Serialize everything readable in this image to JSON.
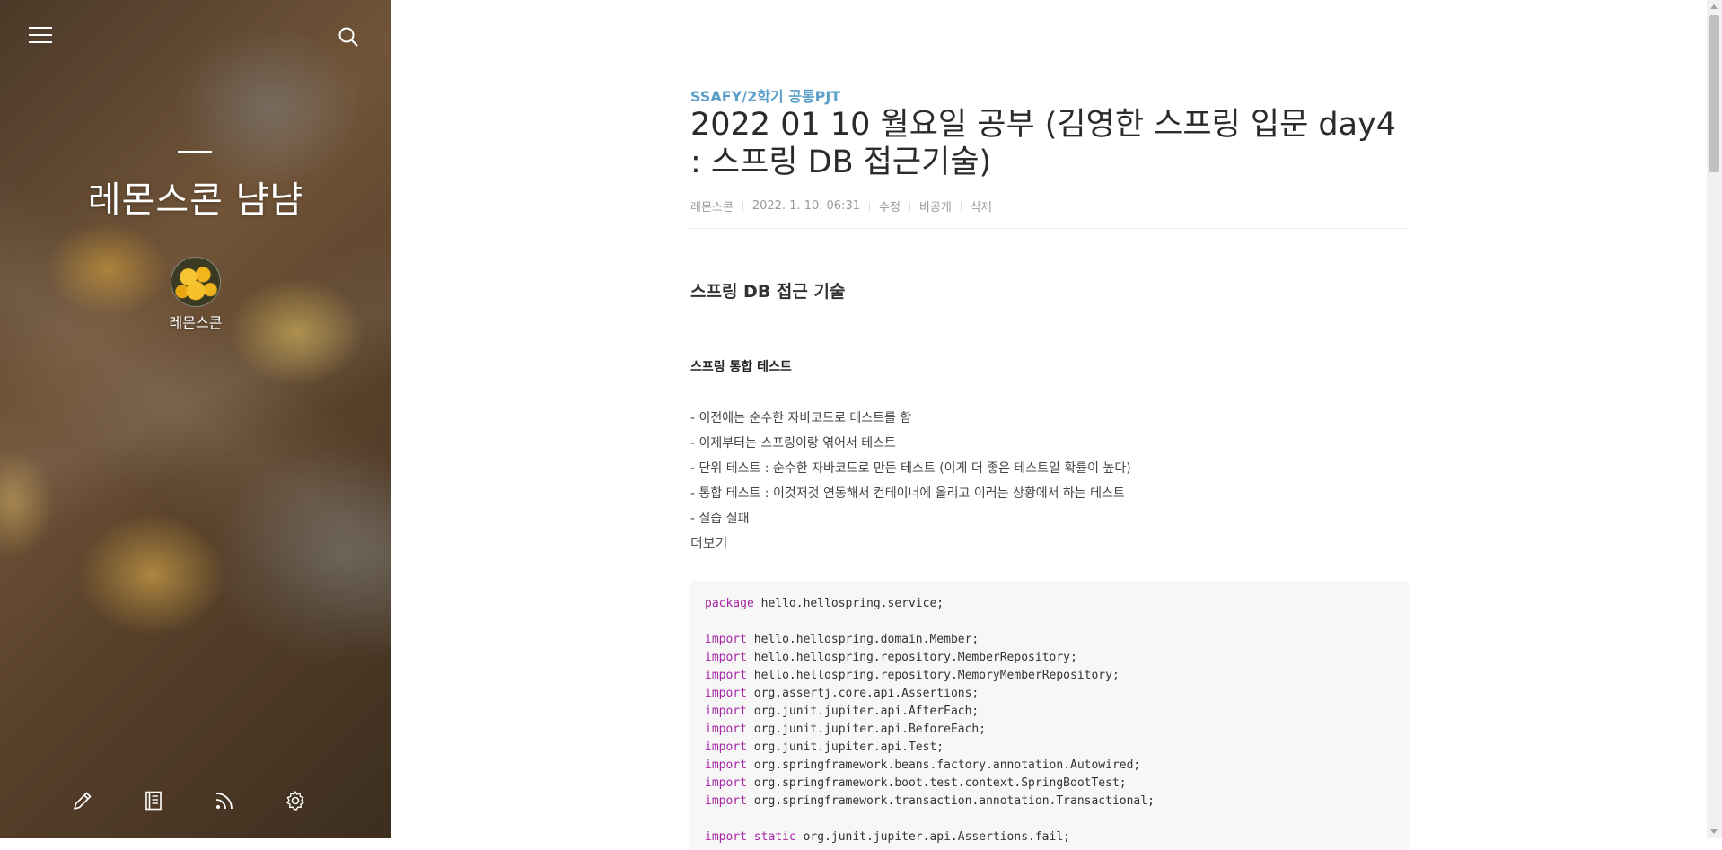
{
  "sidebar": {
    "menu_icon": "hamburger-icon",
    "search_icon": "search-icon",
    "blog_title": "레몬스콘 냠냠",
    "author_name": "레몬스콘",
    "bottom_icons": [
      "pencil-icon",
      "notebook-icon",
      "rss-icon",
      "gear-icon"
    ]
  },
  "post": {
    "category": "SSAFY/2학기 공통PJT",
    "title": "2022 01 10 월요일 공부 (김영한 스프링 입문 day4 : 스프링 DB 접근기술)",
    "meta": {
      "author": "레몬스콘",
      "date": "2022. 1. 10. 06:31",
      "edit": "수정",
      "visibility": "비공개",
      "delete": "삭제"
    },
    "section_heading": "스프링 DB 접근 기술",
    "sub_heading": "스프링 통합 테스트",
    "bullets": [
      "- 이전에는 순수한 자바코드로 테스트를 함",
      "- 이제부터는 스프링이랑 엮어서 테스트",
      "- 단위 테스트 : 순수한 자바코드로 만든 테스트 (이게 더 좋은 테스트일 확률이 높다)",
      "- 통합 테스트 : 이것저것 연동해서 컨테이너에 올리고 이러는 상황에서 하는 테스트",
      "- 실습 실패"
    ],
    "more_link": "더보기",
    "code": {
      "line1": {
        "kw": "package",
        "rest": " hello.hellospring.service;"
      },
      "imports": [
        {
          "kw": "import",
          "rest": " hello.hellospring.domain.Member;"
        },
        {
          "kw": "import",
          "rest": " hello.hellospring.repository.MemberRepository;"
        },
        {
          "kw": "import",
          "rest": " hello.hellospring.repository.MemoryMemberRepository;"
        },
        {
          "kw": "import",
          "rest": " org.assertj.core.api.Assertions;"
        },
        {
          "kw": "import",
          "rest": " org.junit.jupiter.api.AfterEach;"
        },
        {
          "kw": "import",
          "rest": " org.junit.jupiter.api.BeforeEach;"
        },
        {
          "kw": "import",
          "rest": " org.junit.jupiter.api.Test;"
        },
        {
          "kw": "import",
          "rest": " org.springframework.beans.factory.annotation.Autowired;"
        },
        {
          "kw": "import",
          "rest": " org.springframework.boot.test.context.SpringBootTest;"
        },
        {
          "kw": "import",
          "rest": " org.springframework.transaction.annotation.Transactional;"
        }
      ],
      "static_import": {
        "kw": "import static",
        "rest": " org.junit.jupiter.api.Assertions.fail;"
      }
    }
  }
}
